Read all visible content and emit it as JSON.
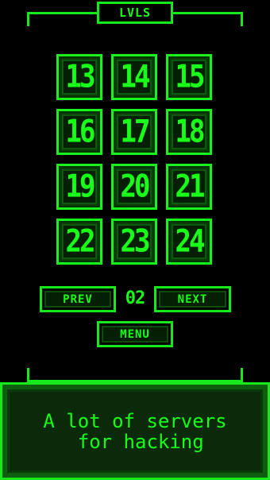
{
  "header": {
    "title": "LVLS"
  },
  "levels": [
    {
      "number": "13"
    },
    {
      "number": "14"
    },
    {
      "number": "15"
    },
    {
      "number": "16"
    },
    {
      "number": "17"
    },
    {
      "number": "18"
    },
    {
      "number": "19"
    },
    {
      "number": "20"
    },
    {
      "number": "21"
    },
    {
      "number": "22"
    },
    {
      "number": "23"
    },
    {
      "number": "24"
    }
  ],
  "pager": {
    "prev_label": "PREV",
    "page": "02",
    "next_label": "NEXT"
  },
  "menu": {
    "label": "MENU"
  },
  "dialog": {
    "line1": "A lot of servers",
    "line2": " for hacking"
  },
  "colors": {
    "accent": "#17ff17",
    "tile_fill": "#0f6b10",
    "background": "#000000",
    "dialog_fill": "#0a2a0a"
  }
}
